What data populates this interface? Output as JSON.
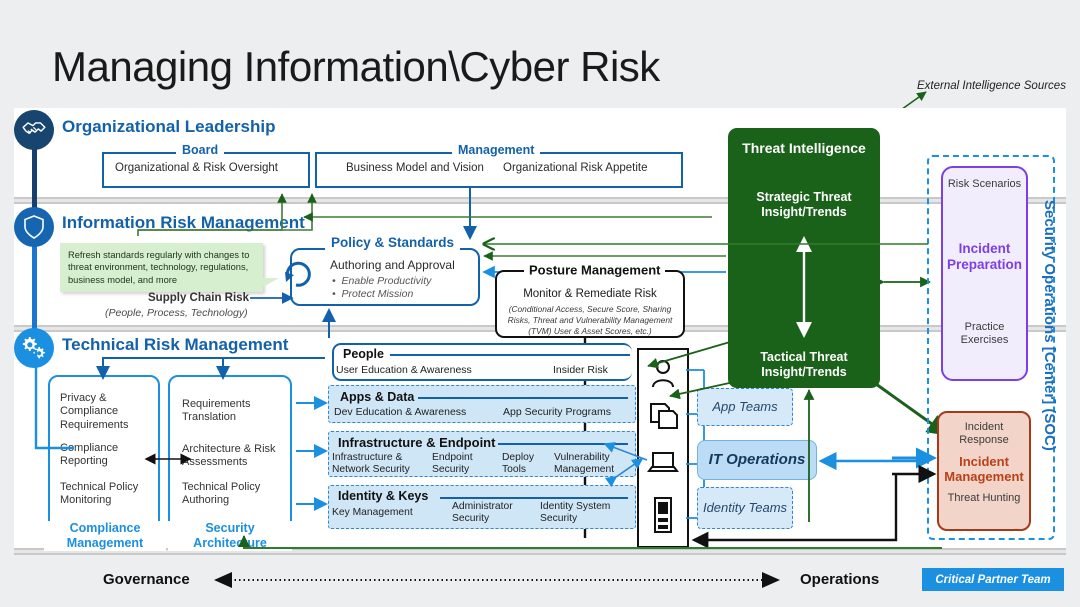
{
  "title": "Managing Information\\Cyber Risk",
  "external_label": "External Intelligence Sources",
  "sections": {
    "leadership": {
      "title": "Organizational Leadership",
      "icon": "handshake-icon",
      "board": {
        "label": "Board",
        "items": [
          "Organizational & Risk Oversight"
        ]
      },
      "management": {
        "label": "Management",
        "items": [
          "Business Model and Vision",
          "Organizational Risk Appetite"
        ]
      }
    },
    "information_risk": {
      "title": "Information Risk Management",
      "icon": "shield-icon",
      "callout": "Refresh standards regularly with changes to threat environment, technology, regulations, business model, and more",
      "supply_chain": "Supply Chain Risk",
      "supply_chain_sub": "(People, Process, Technology)",
      "policy": {
        "label": "Policy & Standards",
        "heading": "Authoring and Approval",
        "bullets": [
          "Enable Productivity",
          "Protect Mission"
        ]
      }
    },
    "technical_risk": {
      "title": "Technical Risk Management",
      "icon": "gears-icon",
      "compliance": {
        "label": "Compliance Management",
        "items": [
          "Privacy & Compliance Requirements",
          "Compliance Reporting",
          "Technical Policy Monitoring"
        ]
      },
      "architecture": {
        "label": "Security Architecture",
        "items": [
          "Requirements Translation",
          "Architecture & Risk Assessments",
          "Technical Policy Authoring"
        ]
      }
    }
  },
  "posture": {
    "label": "Posture Management",
    "heading": "Monitor & Remediate Risk",
    "note": "(Conditional Access, Secure Score, Sharing Risks, Threat and Vulnerability Management (TVM) User & Asset Scores, etc.)"
  },
  "capabilities": [
    {
      "title": "People",
      "icon": "person-icon",
      "items": [
        "User Education & Awareness",
        "Insider Risk"
      ],
      "team": "App Teams"
    },
    {
      "title": "Apps & Data",
      "icon": "documents-icon",
      "items": [
        "Dev Education & Awareness",
        "App Security Programs"
      ],
      "team": "App Teams"
    },
    {
      "title": "Infrastructure & Endpoint",
      "icon": "laptop-icon",
      "items": [
        "Infrastructure & Network Security",
        "Endpoint Security",
        "Deploy Tools",
        "Vulnerability Management"
      ],
      "team": "IT Operations"
    },
    {
      "title": "Identity & Keys",
      "icon": "server-icon",
      "items": [
        "Key Management",
        "Administrator Security",
        "Identity System Security"
      ],
      "team": "Identity Teams"
    }
  ],
  "teams": [
    {
      "name": "App Teams",
      "highlight": false
    },
    {
      "name": "IT Operations",
      "highlight": true
    },
    {
      "name": "Identity Teams",
      "highlight": false
    }
  ],
  "threat_intelligence": {
    "title": "Threat Intelligence",
    "top": "Strategic Threat Insight/Trends",
    "bottom": "Tactical Threat Insight/Trends"
  },
  "soc": {
    "label": "Security Operations [Center] (SOC)",
    "preparation": {
      "top": "Risk Scenarios",
      "main": "Incident Preparation",
      "bottom": "Practice Exercises"
    },
    "management": {
      "top": "Incident Response",
      "main": "Incident Management",
      "bottom": "Threat Hunting"
    }
  },
  "footer": {
    "governance": "Governance",
    "operations": "Operations",
    "critical_partner": "Critical Partner Team"
  },
  "colors": {
    "brand_blue": "#1461ab",
    "light_blue": "#1b8fe0",
    "band_fill": "#cfe6f7",
    "green": "#1a6119",
    "purple": "#7b3fe4",
    "red": "#a63a18",
    "callout_green": "#d6f0cf"
  }
}
